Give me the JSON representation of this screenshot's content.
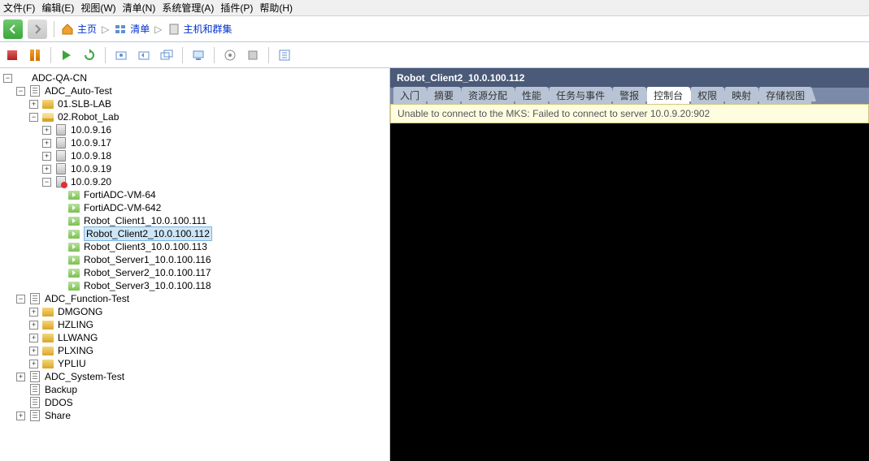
{
  "menu": {
    "file": "文件(F)",
    "edit": "编辑(E)",
    "view": "视图(W)",
    "inventory": "清单(N)",
    "admin": "系统管理(A)",
    "plugins": "插件(P)",
    "help": "帮助(H)"
  },
  "nav": {
    "home": "主页",
    "inventory": "清单",
    "hosts_clusters": "主机和群集",
    "arrow": "▷"
  },
  "tree": {
    "root": "ADC-QA-CN",
    "auto_test": "ADC_Auto-Test",
    "slb_lab": "01.SLB-LAB",
    "robot_lab": "02.Robot_Lab",
    "hosts": [
      "10.0.9.16",
      "10.0.9.17",
      "10.0.9.18",
      "10.0.9.19"
    ],
    "host_warn": "10.0.9.20",
    "vms": [
      "FortiADC-VM-64",
      "FortiADC-VM-642",
      "Robot_Client1_10.0.100.111",
      "Robot_Client2_10.0.100.112",
      "Robot_Client3_10.0.100.113",
      "Robot_Server1_10.0.100.116",
      "Robot_Server2_10.0.100.117",
      "Robot_Server3_10.0.100.118"
    ],
    "func_test": "ADC_Function-Test",
    "func_children": [
      "DMGONG",
      "HZLING",
      "LLWANG",
      "PLXING",
      "YPLIU"
    ],
    "sys_test": "ADC_System-Test",
    "backup": "Backup",
    "ddos": "DDOS",
    "share": "Share",
    "exp_minus": "−",
    "exp_plus": "+"
  },
  "panel": {
    "title": "Robot_Client2_10.0.100.112",
    "tabs": [
      "入门",
      "摘要",
      "资源分配",
      "性能",
      "任务与事件",
      "警报",
      "控制台",
      "权限",
      "映射",
      "存储视图"
    ],
    "active_tab_index": 6,
    "warning": "Unable to connect to the MKS: Failed to connect to server 10.0.9.20:902"
  },
  "selected_vm_index": 3
}
